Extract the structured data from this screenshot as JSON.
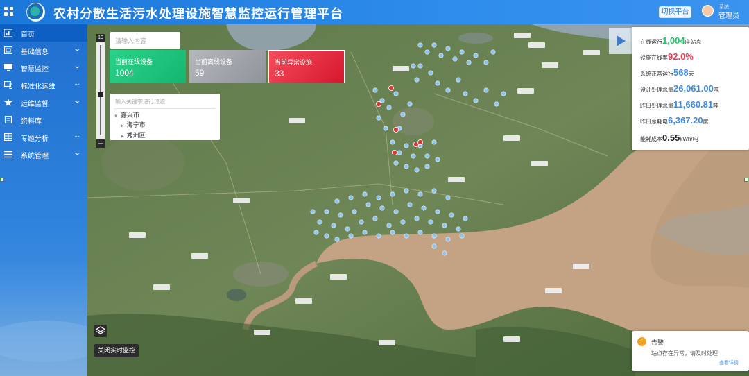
{
  "header": {
    "title": "农村分散生活污水处理设施智慧监控运行管理平台",
    "switch_label": "切换平台",
    "user_name_small": "系统",
    "user_role": "管理员"
  },
  "sidebar": {
    "items": [
      {
        "label": "首页",
        "icon": "chart-icon",
        "active": true,
        "arrow": false
      },
      {
        "label": "基础信息",
        "icon": "window-icon",
        "active": false,
        "arrow": true
      },
      {
        "label": "智慧监控",
        "icon": "monitor-icon",
        "active": false,
        "arrow": true
      },
      {
        "label": "标准化运维",
        "icon": "device-icon",
        "active": false,
        "arrow": true
      },
      {
        "label": "运维监督",
        "icon": "star-icon",
        "active": false,
        "arrow": true
      },
      {
        "label": "资料库",
        "icon": "document-icon",
        "active": false,
        "arrow": false
      },
      {
        "label": "专题分析",
        "icon": "table-icon",
        "active": false,
        "arrow": true
      },
      {
        "label": "系统管理",
        "icon": "list-icon",
        "active": false,
        "arrow": true
      }
    ]
  },
  "map": {
    "zoom_top": "10",
    "zoom_bottom": "—",
    "search_placeholder": "请输入内容",
    "cards": [
      {
        "label": "当前在线设备",
        "value": "1004"
      },
      {
        "label": "当前离线设备",
        "value": "59"
      },
      {
        "label": "当前异常设施",
        "value": "33"
      }
    ],
    "tree": {
      "search_placeholder": "输入关键字进行过滤",
      "root": "嘉兴市",
      "children": [
        "海宁市",
        "秀洲区"
      ]
    },
    "stats": {
      "online_prefix": "在线运行",
      "online_value": "1,004",
      "online_suffix": "座站点",
      "rate_prefix": "设施在线率",
      "rate_value": "92.0%",
      "days_prefix": "系统正常运行",
      "days_value": "568",
      "days_suffix": "天",
      "design_prefix": "设计处理水量",
      "design_value": "26,061.00",
      "design_suffix": "吨",
      "yesterday_prefix": "昨日处理水量",
      "yesterday_value": "11,660.81",
      "yesterday_suffix": "吨",
      "power_prefix": "昨日总耗电",
      "power_value": "6,367.20",
      "power_suffix": "度",
      "cost_prefix": "能耗成本",
      "cost_value": "0.55",
      "cost_suffix": "kWh/吨"
    },
    "realtime_button": "关闭实时监控",
    "alert": {
      "title": "告警",
      "message": "站点存在异常，请及时处理",
      "link": "查看详情"
    }
  }
}
